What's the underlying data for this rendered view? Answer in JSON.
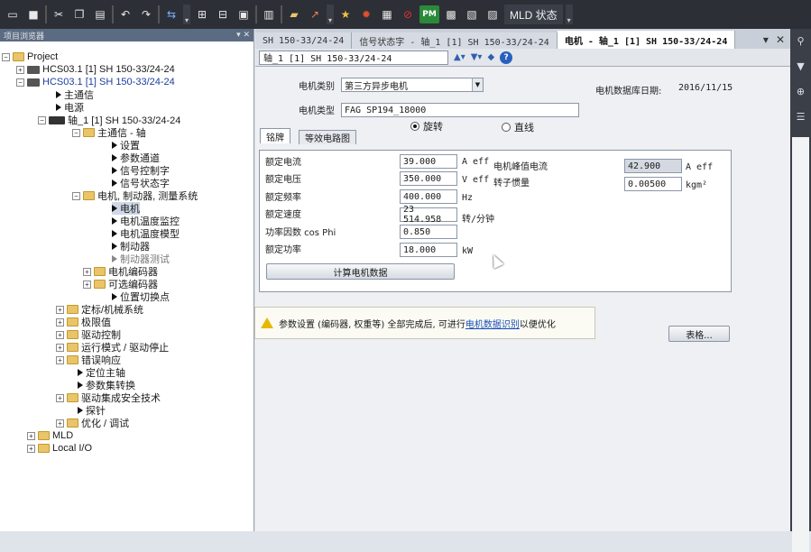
{
  "toolbar": {
    "mld_label": "MLD 状态",
    "pm_label": "PM",
    "icons": [
      "monitor-icon",
      "save-icon",
      "cut-icon",
      "copy-icon",
      "paste-icon",
      "undo-icon",
      "redo-icon",
      "connect-icon",
      "download-icon",
      "upload-icon",
      "compare-icon",
      "open-icon",
      "export-icon",
      "star-icon",
      "tool-icon",
      "table-icon",
      "stop-icon",
      "grid-icon",
      "chart-icon"
    ]
  },
  "tree": {
    "panel_title": "项目浏览器",
    "items": [
      {
        "label": "Project",
        "level": 0
      },
      {
        "label": "HCS03.1 [1] SH 150-33/24-24",
        "level": 1
      },
      {
        "label": "HCS03.1 [1] SH 150-33/24-24",
        "level": 1
      },
      {
        "label": "主通信",
        "level": 2
      },
      {
        "label": "电源",
        "level": 2
      },
      {
        "label": "轴_1 [1] SH 150-33/24-24",
        "level": 2
      },
      {
        "label": "主通信 - 轴",
        "level": 3
      },
      {
        "label": "设置",
        "level": 4
      },
      {
        "label": "参数通道",
        "level": 4
      },
      {
        "label": "信号控制字",
        "level": 4
      },
      {
        "label": "信号状态字",
        "level": 4
      },
      {
        "label": "电机, 制动器, 测量系统",
        "level": 3
      },
      {
        "label": "电机",
        "level": 4
      },
      {
        "label": "电机温度监控",
        "level": 4
      },
      {
        "label": "电机温度模型",
        "level": 4
      },
      {
        "label": "制动器",
        "level": 4
      },
      {
        "label": "制动器测试",
        "level": 4
      },
      {
        "label": "电机编码器",
        "level": 4
      },
      {
        "label": "可选编码器",
        "level": 4
      },
      {
        "label": "位置切换点",
        "level": 4
      },
      {
        "label": "定标/机械系统",
        "level": 3
      },
      {
        "label": "极限值",
        "level": 3
      },
      {
        "label": "驱动控制",
        "level": 3
      },
      {
        "label": "运行模式 / 驱动停止",
        "level": 3
      },
      {
        "label": "错误响应",
        "level": 3
      },
      {
        "label": "定位主轴",
        "level": 3
      },
      {
        "label": "参数集转换",
        "level": 3
      },
      {
        "label": "驱动集成安全技术",
        "level": 3
      },
      {
        "label": "探针",
        "level": 3
      },
      {
        "label": "优化 / 调试",
        "level": 3
      },
      {
        "label": "MLD",
        "level": 1
      },
      {
        "label": "Local I/O",
        "level": 1
      }
    ]
  },
  "tabs": [
    {
      "label": "SH 150-33/24-24"
    },
    {
      "label": "信号状态字 - 轴_1 [1] SH 150-33/24-24"
    },
    {
      "label": "电机 - 轴_1 [1] SH 150-33/24-24"
    }
  ],
  "subbar": {
    "axis_select": "轴_1 [1] SH 150-33/24-24"
  },
  "motor": {
    "category_label": "电机类别",
    "category_value": "第三方异步电机",
    "db_date_label": "电机数据库日期:",
    "db_date_value": "2016/11/15",
    "type_label": "电机类型",
    "type_value": "FAG SP194_18000",
    "radio_rotary": "旋转",
    "radio_linear": "直线",
    "tab_nameplate": "铭牌",
    "tab_circuit": "等效电路图",
    "fields": [
      {
        "label": "额定电流",
        "value": "39.000",
        "unit": "A eff"
      },
      {
        "label": "额定电压",
        "value": "350.000",
        "unit": "V eff"
      },
      {
        "label": "额定频率",
        "value": "400.000",
        "unit": "Hz"
      },
      {
        "label": "额定速度",
        "value": "23 514.958",
        "unit": "转/分钟"
      },
      {
        "label": "功率因数 cos Phi",
        "value": "0.850",
        "unit": ""
      },
      {
        "label": "额定功率",
        "value": "18.000",
        "unit": "kW"
      }
    ],
    "peak_current_label": "电机峰值电流",
    "peak_current_value": "42.900",
    "peak_current_unit": "A eff",
    "inertia_label": "转子惯量",
    "inertia_value": "0.00500",
    "inertia_unit": "kgm²",
    "calc_button": "计算电机数据"
  },
  "notice": {
    "pre": "参数设置 (编码器, 权重等) 全部完成后, 可进行",
    "link": "电机数据识别",
    "post": "以便优化"
  },
  "table_button": "表格..."
}
